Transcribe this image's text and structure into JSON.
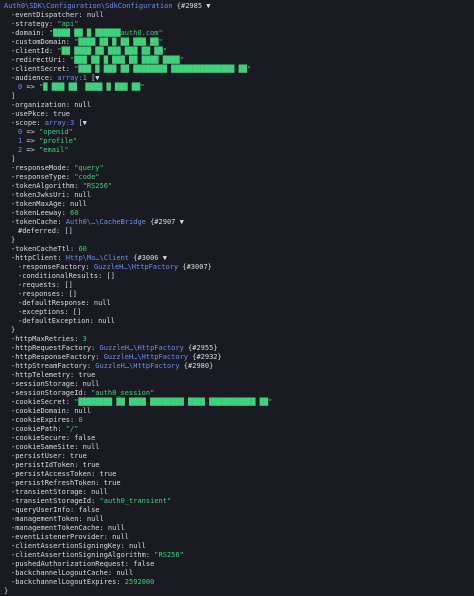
{
  "lines": [
    {
      "indent": 0,
      "parts": [
        {
          "t": "cls",
          "v": "Auth0\\SDK\\Configuration\\SdkConfiguration"
        },
        {
          "t": "plain",
          "v": " {#2985 ▼"
        }
      ]
    },
    {
      "indent": 1,
      "parts": [
        {
          "t": "plain",
          "v": "-eventDispatcher: null"
        }
      ]
    },
    {
      "indent": 1,
      "parts": [
        {
          "t": "plain",
          "v": "-strategy: "
        },
        {
          "t": "str",
          "v": "\"api\""
        }
      ]
    },
    {
      "indent": 1,
      "parts": [
        {
          "t": "plain",
          "v": "-domain: "
        },
        {
          "t": "str",
          "v": "\"████ ██ █ ██████auth0.com\""
        }
      ]
    },
    {
      "indent": 1,
      "parts": [
        {
          "t": "plain",
          "v": "-customDomain: "
        },
        {
          "t": "str",
          "v": "\"████ ██ █ ██ ███ ██\""
        }
      ]
    },
    {
      "indent": 1,
      "parts": [
        {
          "t": "plain",
          "v": "-clientId: "
        },
        {
          "t": "str",
          "v": "\"██ ████ ██ ███ ███ ██ ██\""
        }
      ]
    },
    {
      "indent": 1,
      "parts": [
        {
          "t": "plain",
          "v": "-redirectUri: "
        },
        {
          "t": "str",
          "v": "\"███ ██ █ ███ ██ ████ ████\""
        }
      ]
    },
    {
      "indent": 1,
      "parts": [
        {
          "t": "plain",
          "v": "-clientSecret: "
        },
        {
          "t": "str",
          "v": "\"███ █ ███ ██ ████████ ███████████████ ██\""
        }
      ]
    },
    {
      "indent": 1,
      "parts": [
        {
          "t": "plain",
          "v": "-audience: "
        },
        {
          "t": "cls",
          "v": "array:1"
        },
        {
          "t": "plain",
          "v": " [▼"
        }
      ]
    },
    {
      "indent": 2,
      "parts": [
        {
          "t": "cls",
          "v": "0"
        },
        {
          "t": "plain",
          "v": " => "
        },
        {
          "t": "str",
          "v": "\"█ ███ ██  ████ █ ███ ██\""
        }
      ]
    },
    {
      "indent": 1,
      "parts": [
        {
          "t": "plain",
          "v": "]"
        }
      ]
    },
    {
      "indent": 1,
      "parts": [
        {
          "t": "plain",
          "v": "-organization: null"
        }
      ]
    },
    {
      "indent": 1,
      "parts": [
        {
          "t": "plain",
          "v": "-usePkce: true"
        }
      ]
    },
    {
      "indent": 1,
      "parts": [
        {
          "t": "plain",
          "v": "-scope: "
        },
        {
          "t": "cls",
          "v": "array:3"
        },
        {
          "t": "plain",
          "v": " [▼"
        }
      ]
    },
    {
      "indent": 2,
      "parts": [
        {
          "t": "cls",
          "v": "0"
        },
        {
          "t": "plain",
          "v": " => "
        },
        {
          "t": "str",
          "v": "\"openid\""
        }
      ]
    },
    {
      "indent": 2,
      "parts": [
        {
          "t": "cls",
          "v": "1"
        },
        {
          "t": "plain",
          "v": " => "
        },
        {
          "t": "str",
          "v": "\"profile\""
        }
      ]
    },
    {
      "indent": 2,
      "parts": [
        {
          "t": "cls",
          "v": "2"
        },
        {
          "t": "plain",
          "v": " => "
        },
        {
          "t": "str",
          "v": "\"email\""
        }
      ]
    },
    {
      "indent": 1,
      "parts": [
        {
          "t": "plain",
          "v": "]"
        }
      ]
    },
    {
      "indent": 1,
      "parts": [
        {
          "t": "plain",
          "v": "-responseMode: "
        },
        {
          "t": "str",
          "v": "\"query\""
        }
      ]
    },
    {
      "indent": 1,
      "parts": [
        {
          "t": "plain",
          "v": "-responseType: "
        },
        {
          "t": "str",
          "v": "\"code\""
        }
      ]
    },
    {
      "indent": 1,
      "parts": [
        {
          "t": "plain",
          "v": "-tokenAlgorithm: "
        },
        {
          "t": "str",
          "v": "\"RS256\""
        }
      ]
    },
    {
      "indent": 1,
      "parts": [
        {
          "t": "plain",
          "v": "-tokenJwksUri: null"
        }
      ]
    },
    {
      "indent": 1,
      "parts": [
        {
          "t": "plain",
          "v": "-tokenMaxAge: null"
        }
      ]
    },
    {
      "indent": 1,
      "parts": [
        {
          "t": "plain",
          "v": "-tokenLeeway: "
        },
        {
          "t": "num",
          "v": "60"
        }
      ]
    },
    {
      "indent": 1,
      "parts": [
        {
          "t": "plain",
          "v": "-tokenCache: "
        },
        {
          "t": "cls",
          "v": "Auth0\\…\\CacheBridge"
        },
        {
          "t": "plain",
          "v": " {#2907 ▼"
        }
      ]
    },
    {
      "indent": 2,
      "parts": [
        {
          "t": "plain",
          "v": "#deferred: []"
        }
      ]
    },
    {
      "indent": 1,
      "parts": [
        {
          "t": "plain",
          "v": "}"
        }
      ]
    },
    {
      "indent": 1,
      "parts": [
        {
          "t": "plain",
          "v": "-tokenCacheTtl: "
        },
        {
          "t": "num",
          "v": "60"
        }
      ]
    },
    {
      "indent": 1,
      "parts": [
        {
          "t": "plain",
          "v": "-httpClient: "
        },
        {
          "t": "cls",
          "v": "Http\\Mo…\\Client"
        },
        {
          "t": "plain",
          "v": " {#3006 ▼"
        }
      ]
    },
    {
      "indent": 2,
      "parts": [
        {
          "t": "plain",
          "v": "-responseFactory: "
        },
        {
          "t": "cls",
          "v": "GuzzleH…\\HttpFactory"
        },
        {
          "t": "plain",
          "v": " {#3007}"
        }
      ]
    },
    {
      "indent": 2,
      "parts": [
        {
          "t": "plain",
          "v": "-conditionalResults: []"
        }
      ]
    },
    {
      "indent": 2,
      "parts": [
        {
          "t": "plain",
          "v": "-requests: []"
        }
      ]
    },
    {
      "indent": 2,
      "parts": [
        {
          "t": "plain",
          "v": "-responses: []"
        }
      ]
    },
    {
      "indent": 2,
      "parts": [
        {
          "t": "plain",
          "v": "-defaultResponse: null"
        }
      ]
    },
    {
      "indent": 2,
      "parts": [
        {
          "t": "plain",
          "v": "-exceptions: []"
        }
      ]
    },
    {
      "indent": 2,
      "parts": [
        {
          "t": "plain",
          "v": "-defaultException: null"
        }
      ]
    },
    {
      "indent": 1,
      "parts": [
        {
          "t": "plain",
          "v": "}"
        }
      ]
    },
    {
      "indent": 1,
      "parts": [
        {
          "t": "plain",
          "v": "-httpMaxRetries: "
        },
        {
          "t": "num",
          "v": "3"
        }
      ]
    },
    {
      "indent": 1,
      "parts": [
        {
          "t": "plain",
          "v": "-httpRequestFactory: "
        },
        {
          "t": "cls",
          "v": "GuzzleH…\\HttpFactory"
        },
        {
          "t": "plain",
          "v": " {#2955}"
        }
      ]
    },
    {
      "indent": 1,
      "parts": [
        {
          "t": "plain",
          "v": "-httpResponseFactory: "
        },
        {
          "t": "cls",
          "v": "GuzzleH…\\HttpFactory"
        },
        {
          "t": "plain",
          "v": " {#2932}"
        }
      ]
    },
    {
      "indent": 1,
      "parts": [
        {
          "t": "plain",
          "v": "-httpStreamFactory: "
        },
        {
          "t": "cls",
          "v": "GuzzleH…\\HttpFactory"
        },
        {
          "t": "plain",
          "v": " {#2980}"
        }
      ]
    },
    {
      "indent": 1,
      "parts": [
        {
          "t": "plain",
          "v": "-httpTelemetry: true"
        }
      ]
    },
    {
      "indent": 1,
      "parts": [
        {
          "t": "plain",
          "v": "-sessionStorage: null"
        }
      ]
    },
    {
      "indent": 1,
      "parts": [
        {
          "t": "plain",
          "v": "-sessionStorageId: "
        },
        {
          "t": "str",
          "v": "\"auth0_session\""
        }
      ]
    },
    {
      "indent": 1,
      "parts": [
        {
          "t": "plain",
          "v": "-cookieSecret: "
        },
        {
          "t": "str",
          "v": "\"████████ ██ ████ ████████ ████ ███████████ ██\""
        }
      ]
    },
    {
      "indent": 1,
      "parts": [
        {
          "t": "plain",
          "v": "-cookieDomain: null"
        }
      ]
    },
    {
      "indent": 1,
      "parts": [
        {
          "t": "plain",
          "v": "-cookieExpires: "
        },
        {
          "t": "num",
          "v": "0"
        }
      ]
    },
    {
      "indent": 1,
      "parts": [
        {
          "t": "plain",
          "v": "-cookiePath: "
        },
        {
          "t": "str",
          "v": "\"/\""
        }
      ]
    },
    {
      "indent": 1,
      "parts": [
        {
          "t": "plain",
          "v": "-cookieSecure: false"
        }
      ]
    },
    {
      "indent": 1,
      "parts": [
        {
          "t": "plain",
          "v": "-cookieSameSite: null"
        }
      ]
    },
    {
      "indent": 1,
      "parts": [
        {
          "t": "plain",
          "v": "-persistUser: true"
        }
      ]
    },
    {
      "indent": 1,
      "parts": [
        {
          "t": "plain",
          "v": "-persistIdToken: true"
        }
      ]
    },
    {
      "indent": 1,
      "parts": [
        {
          "t": "plain",
          "v": "-persistAccessToken: true"
        }
      ]
    },
    {
      "indent": 1,
      "parts": [
        {
          "t": "plain",
          "v": "-persistRefreshToken: true"
        }
      ]
    },
    {
      "indent": 1,
      "parts": [
        {
          "t": "plain",
          "v": "-transientStorage: null"
        }
      ]
    },
    {
      "indent": 1,
      "parts": [
        {
          "t": "plain",
          "v": "-transientStorageId: "
        },
        {
          "t": "str",
          "v": "\"auth0_transient\""
        }
      ]
    },
    {
      "indent": 1,
      "parts": [
        {
          "t": "plain",
          "v": "-queryUserInfo: false"
        }
      ]
    },
    {
      "indent": 1,
      "parts": [
        {
          "t": "plain",
          "v": "-managementToken: null"
        }
      ]
    },
    {
      "indent": 1,
      "parts": [
        {
          "t": "plain",
          "v": "-managementTokenCache: null"
        }
      ]
    },
    {
      "indent": 1,
      "parts": [
        {
          "t": "plain",
          "v": "-eventListenerProvider: null"
        }
      ]
    },
    {
      "indent": 1,
      "parts": [
        {
          "t": "plain",
          "v": "-clientAssertionSigningKey: null"
        }
      ]
    },
    {
      "indent": 1,
      "parts": [
        {
          "t": "plain",
          "v": "-clientAssertionSigningAlgorithm: "
        },
        {
          "t": "str",
          "v": "\"RS256\""
        }
      ]
    },
    {
      "indent": 1,
      "parts": [
        {
          "t": "plain",
          "v": "-pushedAuthorizationRequest: false"
        }
      ]
    },
    {
      "indent": 1,
      "parts": [
        {
          "t": "plain",
          "v": "-backchannelLogoutCache: null"
        }
      ]
    },
    {
      "indent": 1,
      "parts": [
        {
          "t": "plain",
          "v": "-backchannelLogoutExpires: "
        },
        {
          "t": "num",
          "v": "2592000"
        }
      ]
    },
    {
      "indent": 0,
      "parts": [
        {
          "t": "plain",
          "v": "}"
        }
      ]
    }
  ]
}
